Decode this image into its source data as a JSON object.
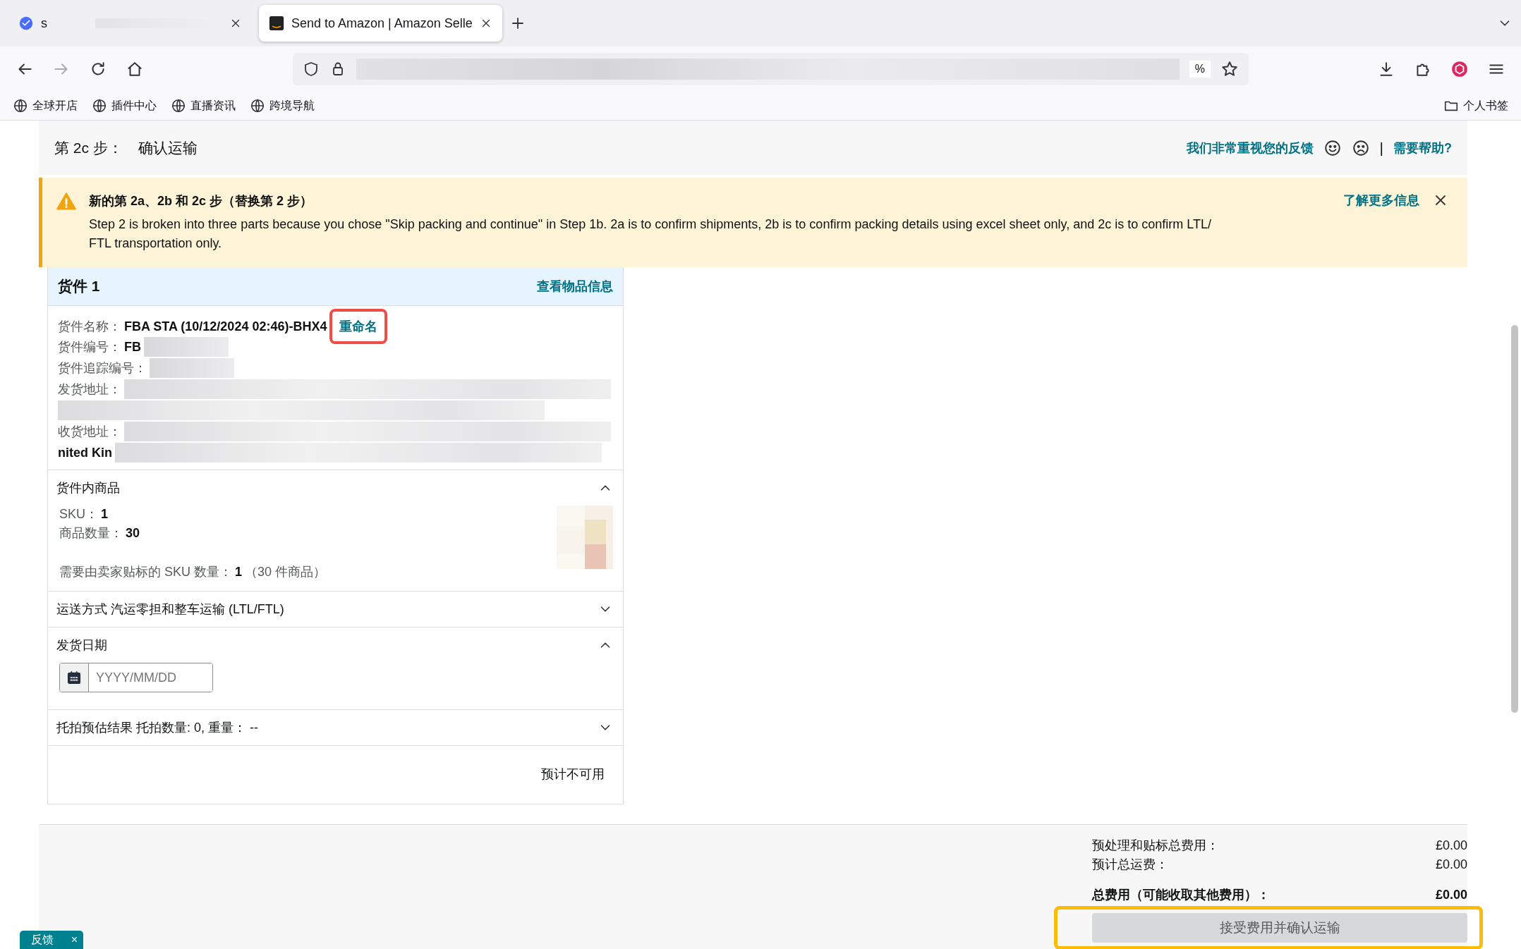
{
  "browser": {
    "tabs": [
      {
        "label": "s",
        "selected": false
      },
      {
        "label": "Send to Amazon | Amazon Selle",
        "selected": true
      }
    ],
    "address": {
      "text": "%"
    },
    "bookmarks": [
      "全球开店",
      "插件中心",
      "直播资讯",
      "跨境导航"
    ],
    "bookmark_folder": "个人书签"
  },
  "header": {
    "step": "第 2c 步：",
    "title": "确认运输",
    "feedback_link": "我们非常重视您的反馈",
    "separator": "|",
    "help_link": "需要帮助?"
  },
  "banner": {
    "title": "新的第 2a、2b 和 2c 步（替换第 2 步）",
    "body": "Step 2 is broken into three parts because you chose \"Skip packing and continue\" in Step 1b. 2a is to confirm shipments, 2b is to confirm packing details using excel sheet only, and 2c is to confirm LTL/ FTL transportation only.",
    "link": "了解更多信息"
  },
  "shipment": {
    "title": "货件 1",
    "view_link": "查看物品信息",
    "details": [
      {
        "kind": "field",
        "label": "货件名称：",
        "value": "FBA STA (10/12/2024 02:46)-BHX4",
        "link": "重命名",
        "highlighted": true,
        "redacted": false
      },
      {
        "kind": "field",
        "label": "货件编号：",
        "value": "FB",
        "redacted": true
      },
      {
        "kind": "field",
        "label": "货件追踪编号：",
        "redacted": true
      },
      {
        "kind": "address",
        "label": "发货地址：",
        "redacted": true
      },
      {
        "kind": "line",
        "redacted": true
      },
      {
        "kind": "address",
        "label": "收货地址：",
        "redacted": true
      },
      {
        "kind": "line",
        "value": "nited Kin",
        "redacted": true
      }
    ],
    "sections": [
      {
        "kind": "items",
        "title": "货件内商品",
        "expanded": true,
        "sku_label": "SKU：",
        "sku": "1",
        "qty_label": "商品数量：",
        "qty": "30",
        "label_count_label": "需要由卖家贴标的 SKU 数量：",
        "label_count": "1",
        "label_count_note": "（30 件商品）"
      },
      {
        "kind": "shipping",
        "title": "运送方式",
        "value": "汽运零担和整车运输 (LTL/FTL)",
        "expanded": false
      },
      {
        "kind": "date",
        "title": "发货日期",
        "expanded": true,
        "placeholder": "YYYY/MM/DD"
      },
      {
        "kind": "pallet",
        "title": "托拍预估结果 托拍数量: 0, 重量：  --",
        "expanded": false
      }
    ],
    "estimate": "预计不可用"
  },
  "fees": [
    {
      "label": "预处理和贴标总费用：",
      "value": "£0.00",
      "bold": false
    },
    {
      "label": "预计总运费：",
      "value": "£0.00",
      "bold": false
    },
    {
      "label": "总费用（可能收取其他费用）：",
      "value": "£0.00",
      "bold": true
    }
  ],
  "confirm_button": {
    "label": "接受费用并确认运输",
    "disabled": true,
    "highlighted": true
  },
  "feedback_tab": {
    "label": "反馈",
    "close": "×"
  }
}
